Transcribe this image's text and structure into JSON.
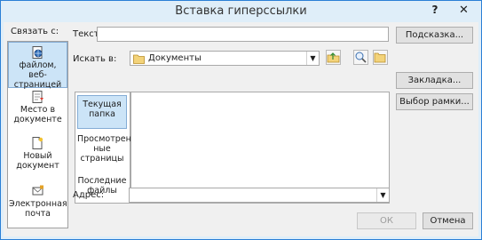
{
  "dialog": {
    "title": "Вставка гиперссылки",
    "help": "?",
    "close": "✕"
  },
  "link_to": {
    "label": "Связать с:",
    "items": [
      {
        "label": "файлом, веб-страницей",
        "icon": "globe-page-icon"
      },
      {
        "label": "Место в документе",
        "icon": "document-bookmark-icon"
      },
      {
        "label": "Новый документ",
        "icon": "new-document-icon"
      },
      {
        "label": "Электронная почта",
        "icon": "mail-icon"
      }
    ]
  },
  "text_field": {
    "label": "Текст:",
    "value": ""
  },
  "hint_button": "Подсказка...",
  "look_in": {
    "label": "Искать в:",
    "value": "Документы",
    "icon": "folder-icon"
  },
  "views": [
    {
      "label": "Текущая папка"
    },
    {
      "label": "Просмотрен-ные страницы"
    },
    {
      "label": "Последние файлы"
    }
  ],
  "bookmark_button": "Закладка...",
  "frame_button": "Выбор рамки...",
  "address": {
    "label": "Адрес:",
    "value": ""
  },
  "ok_button": "ОК",
  "cancel_button": "Отмена"
}
